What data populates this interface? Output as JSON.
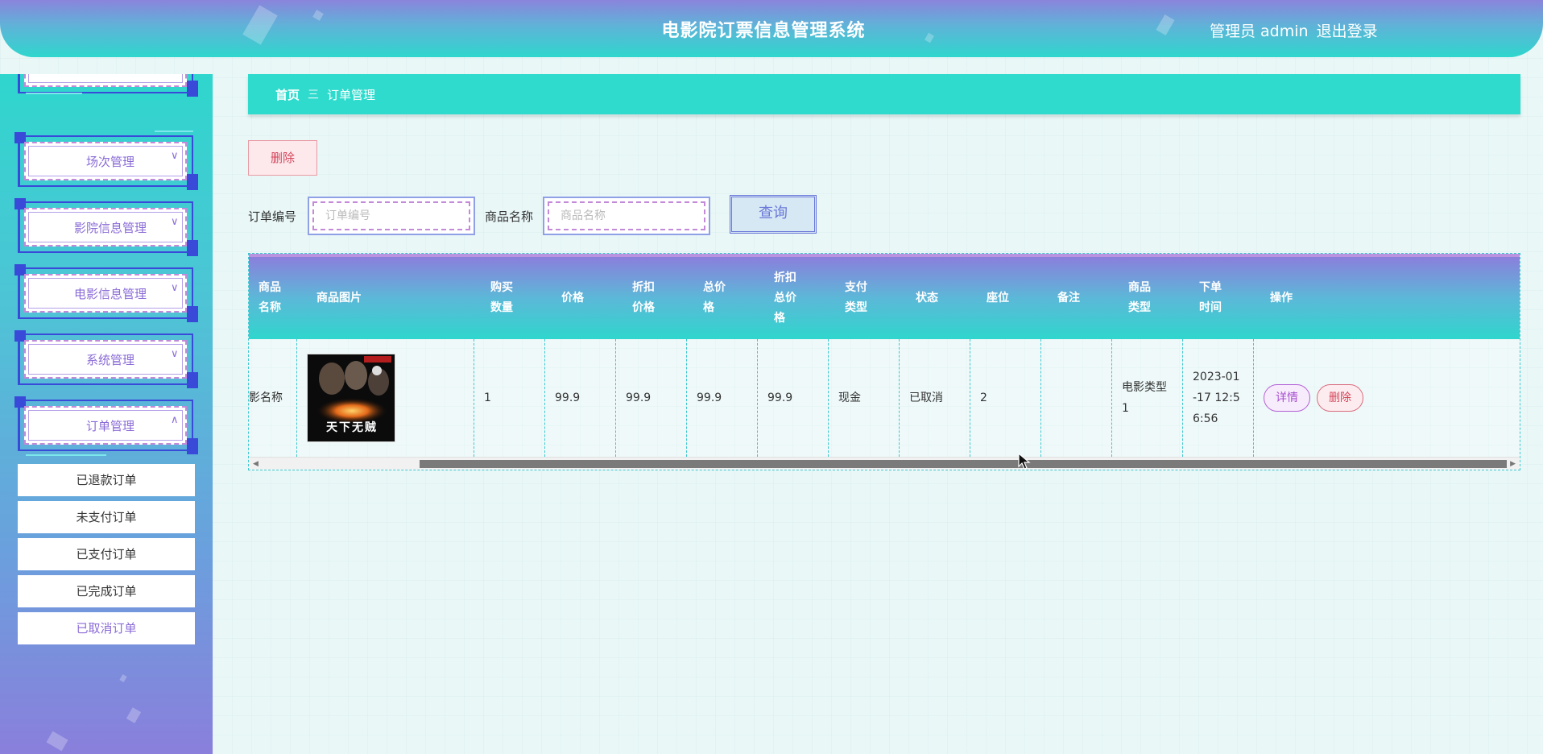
{
  "header": {
    "title": "电影院订票信息管理系统",
    "user_label": "管理员 admin",
    "logout_label": "退出登录"
  },
  "sidebar": {
    "items": [
      {
        "label": "场次管理",
        "icon": "chevron-down-icon"
      },
      {
        "label": "影院信息管理",
        "icon": "chevron-down-icon"
      },
      {
        "label": "电影信息管理",
        "icon": "chevron-down-icon"
      },
      {
        "label": "系统管理",
        "icon": "chevron-down-icon"
      },
      {
        "label": "订单管理",
        "icon": "chevron-up-icon"
      }
    ],
    "subitems": [
      "已退款订单",
      "未支付订单",
      "已支付订单",
      "已完成订单",
      "已取消订单"
    ],
    "active_subitem": "已取消订单"
  },
  "breadcrumb": {
    "home": "首页",
    "separator": "三",
    "current": "订单管理"
  },
  "toolbar": {
    "delete_label": "删除",
    "order_no_label": "订单编号",
    "order_no_placeholder": "订单编号",
    "product_name_label": "商品名称",
    "product_name_placeholder": "商品名称",
    "query_label": "查询"
  },
  "table": {
    "headers": {
      "product_name": [
        "商品",
        "名称"
      ],
      "product_image": "商品图片",
      "quantity": [
        "购买",
        "数量"
      ],
      "price": "价格",
      "discount_price": [
        "折扣",
        "价格"
      ],
      "total_price": [
        "总价",
        "格"
      ],
      "discount_total": [
        "折扣",
        "总价",
        "格"
      ],
      "pay_type": [
        "支付",
        "类型"
      ],
      "status": "状态",
      "seat": "座位",
      "remark": "备注",
      "product_type": [
        "商品",
        "类型"
      ],
      "order_time": [
        "下单",
        "时间"
      ],
      "actions": "操作"
    },
    "rows": [
      {
        "product_name": "影名称",
        "product_image_icon": "movie-poster-image",
        "poster_title": "天下无贼",
        "quantity": "1",
        "price": "99.9",
        "discount_price": "99.9",
        "total_price": "99.9",
        "discount_total": "99.9",
        "pay_type": "现金",
        "status": "已取消",
        "seat": "2",
        "remark": "",
        "product_type": [
          "电影类型",
          "1"
        ],
        "order_time": [
          "2023-01",
          "-17 12:5",
          "6:56"
        ],
        "detail_label": "详情",
        "delete_label": "删除"
      }
    ]
  },
  "colors": {
    "header_top": "#8a84dc",
    "header_bottom": "#2fd6cd",
    "accent_purple": "#8a6bd6",
    "breadcrumb_bg": "#2edbcd",
    "delete_red": "#d4455a"
  }
}
